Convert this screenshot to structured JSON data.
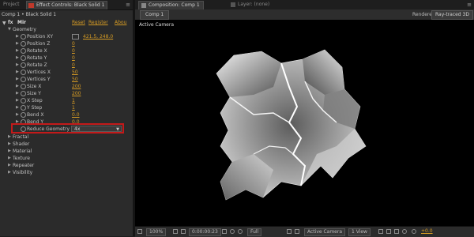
{
  "left_panel": {
    "tabs": {
      "project": "Project",
      "effect_controls": "Effect Controls: Black Solid 1",
      "menu": "≡"
    },
    "breadcrumb": "Comp 1 • Black Solid 1",
    "effect": {
      "fx": "fx",
      "name": "Mir",
      "reset": "Reset",
      "register": "Register",
      "about": "Abou"
    },
    "geometry_label": "Geometry",
    "properties": [
      {
        "label": "Position XY",
        "value": "421.5, 248.0"
      },
      {
        "label": "Position Z",
        "value": "0"
      },
      {
        "label": "Rotate X",
        "value": "0"
      },
      {
        "label": "Rotate Y",
        "value": "0"
      },
      {
        "label": "Rotate Z",
        "value": "0"
      },
      {
        "label": "Vertices X",
        "value": "50"
      },
      {
        "label": "Vertices Y",
        "value": "50"
      },
      {
        "label": "Size X",
        "value": "200"
      },
      {
        "label": "Size Y",
        "value": "200"
      },
      {
        "label": "X Step",
        "value": "1"
      },
      {
        "label": "Y Step",
        "value": "1"
      },
      {
        "label": "Bend X",
        "value": "0.0"
      },
      {
        "label": "Bend Y",
        "value": "0.0"
      }
    ],
    "reduce_geometry": {
      "label": "Reduce Geometry",
      "value": "4x"
    },
    "groups": [
      "Fractal",
      "Shader",
      "Material",
      "Texture",
      "Repeater",
      "Visibility"
    ]
  },
  "right_panel": {
    "tabs": {
      "composition": "Composition: Comp 1",
      "layer": "Layer: (none)",
      "menu": "≡"
    },
    "comp_tab": "Comp 1",
    "renderer_label": "Renderer:",
    "renderer_value": "Ray-traced 3D",
    "viewer_label": "Active Camera",
    "bottom": {
      "zoom": "100%",
      "timecode": "0:00:00:23",
      "resolution": "Full",
      "camera": "Active Camera",
      "views": "1 View",
      "exposure": "+0.0"
    }
  },
  "colors": {
    "accent": "#d49a24",
    "highlight": "#c31a1a",
    "viewer_bg": "#000000"
  }
}
